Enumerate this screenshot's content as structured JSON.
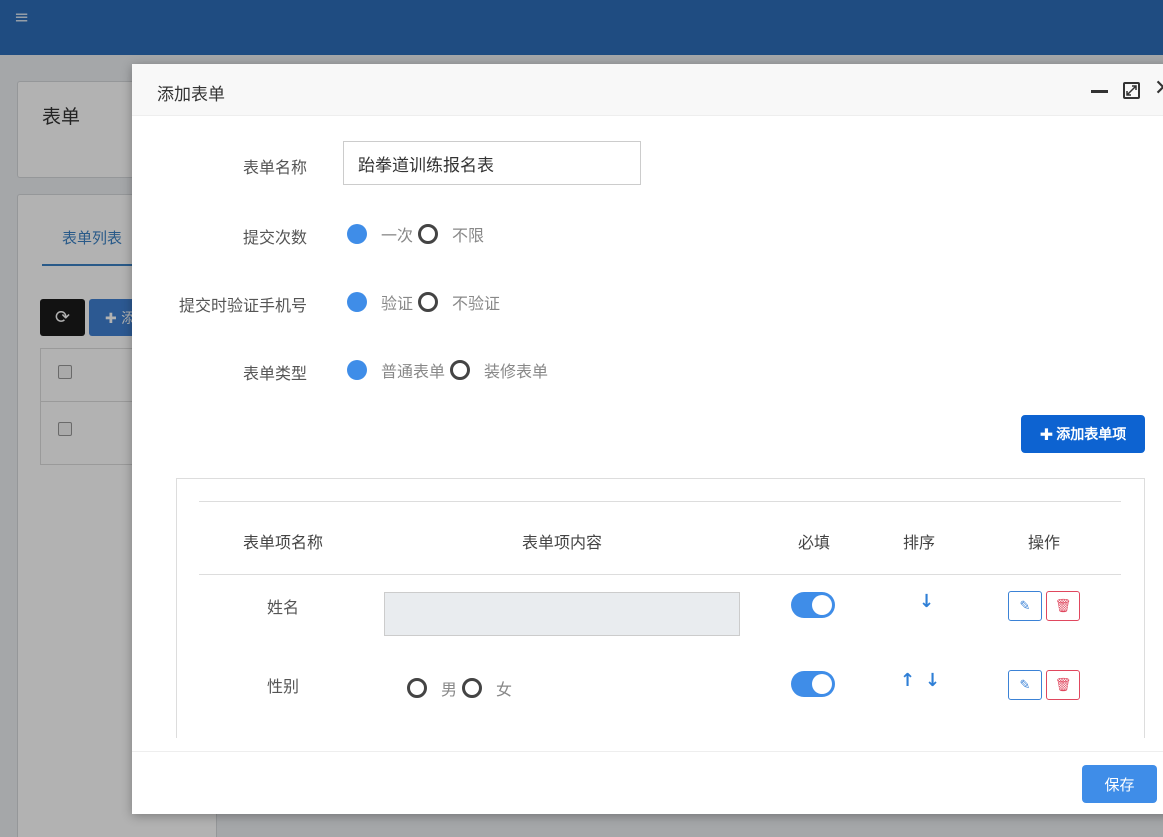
{
  "background": {
    "page_title": "表单",
    "tab_label": "表单列表",
    "add_button_label": "添"
  },
  "modal": {
    "title": "添加表单",
    "form_name_label": "表单名称",
    "form_name_value": "跆拳道训练报名表",
    "submit_count": {
      "label": "提交次数",
      "options": [
        "一次",
        "不限"
      ],
      "selected": "一次"
    },
    "verify_phone": {
      "label": "提交时验证手机号",
      "options": [
        "验证",
        "不验证"
      ],
      "selected": "验证"
    },
    "form_type": {
      "label": "表单类型",
      "options": [
        "普通表单",
        "装修表单"
      ],
      "selected": "普通表单"
    },
    "add_item_button": "添加表单项",
    "items_table": {
      "headers": [
        "表单项名称",
        "表单项内容",
        "必填",
        "排序",
        "操作"
      ],
      "rows": [
        {
          "name": "姓名",
          "content_type": "text-input",
          "required": true,
          "sort": [
            "down"
          ]
        },
        {
          "name": "性别",
          "content_type": "radio",
          "options": [
            "男",
            "女"
          ],
          "required": true,
          "sort": [
            "up",
            "down"
          ]
        }
      ]
    },
    "save_button": "保存"
  },
  "colors": {
    "topbar": "#2d6db9",
    "primary": "#3f8de8",
    "add_item_button": "#0d63d1",
    "danger": "#e0475e"
  },
  "icons": [
    "hamburger-icon",
    "refresh-icon",
    "minimize-icon",
    "maximize-icon",
    "close-icon",
    "plus-icon",
    "edit-icon",
    "delete-icon",
    "arrow-up-icon",
    "arrow-down-icon"
  ]
}
